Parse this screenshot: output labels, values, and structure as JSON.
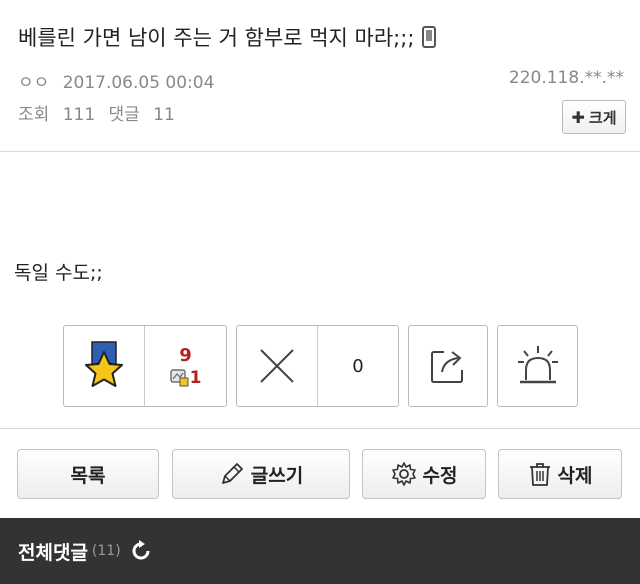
{
  "post": {
    "title": "베를린 가면 남이 주는 거 함부로 먹지 마라;;;",
    "author": "ㅇㅇ",
    "datetime": "2017.06.05 00:04",
    "ip": "220.118.**.**",
    "views_label": "조회",
    "views": "111",
    "comments_label": "댓글",
    "comments": "11",
    "size_button": "크게",
    "body": "독일 수도;;"
  },
  "votes": {
    "up_count": "9",
    "up_sub_count": "1",
    "down_count": "0"
  },
  "actions": {
    "list_label": "목록",
    "write_label": "글쓰기",
    "edit_label": "수정",
    "delete_label": "삭제"
  },
  "comments_bar": {
    "title": "전체댓글",
    "count": "(11)"
  },
  "colors": {
    "accent_red": "#b22222",
    "footer_bg": "#333333",
    "star_yellow": "#f5c518",
    "badge_blue": "#2f5fb0"
  },
  "icons": [
    "mobile-icon",
    "star-badge-icon",
    "x-icon",
    "share-icon",
    "siren-icon",
    "pencil-icon",
    "gear-icon",
    "trash-icon",
    "refresh-icon"
  ]
}
